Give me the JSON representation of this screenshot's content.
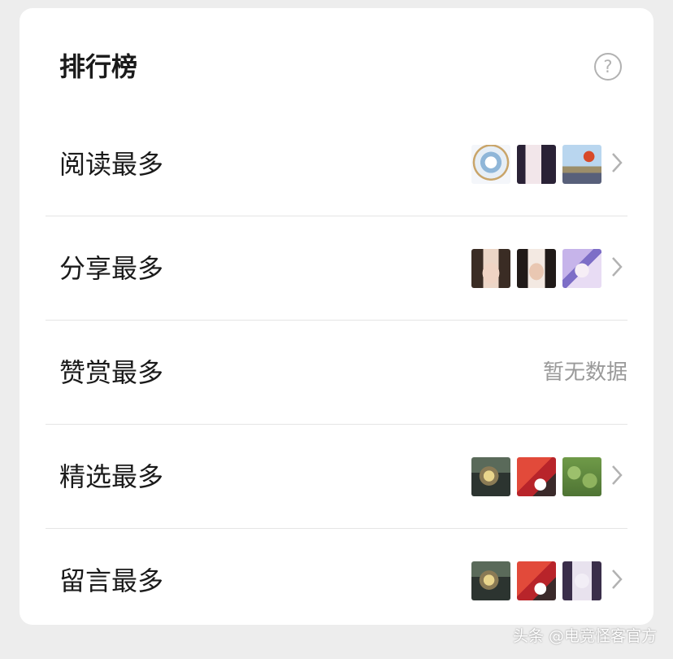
{
  "header": {
    "title": "排行榜",
    "help_glyph": "?"
  },
  "rows": [
    {
      "label": "阅读最多",
      "thumbs": [
        "ornate-figure",
        "anime-girl-dark-hair",
        "hot-air-balloon"
      ],
      "empty_text": null
    },
    {
      "label": "分享最多",
      "thumbs": [
        "girl-selfie-1",
        "girl-selfie-2",
        "anime-girl-purple"
      ],
      "empty_text": null
    },
    {
      "label": "赞赏最多",
      "thumbs": [],
      "empty_text": "暂无数据"
    },
    {
      "label": "精选最多",
      "thumbs": [
        "golden-dragon",
        "red-character-10",
        "succulent-plant"
      ],
      "empty_text": null
    },
    {
      "label": "留言最多",
      "thumbs": [
        "golden-dragon",
        "red-character-10",
        "anime-girl-sketch"
      ],
      "empty_text": null
    }
  ],
  "watermark": "头条 @电竞怪客官方",
  "colors": {
    "background": "#ededed",
    "card": "#ffffff",
    "divider": "#e5e5e5",
    "secondary_text": "#9a9a9a"
  }
}
